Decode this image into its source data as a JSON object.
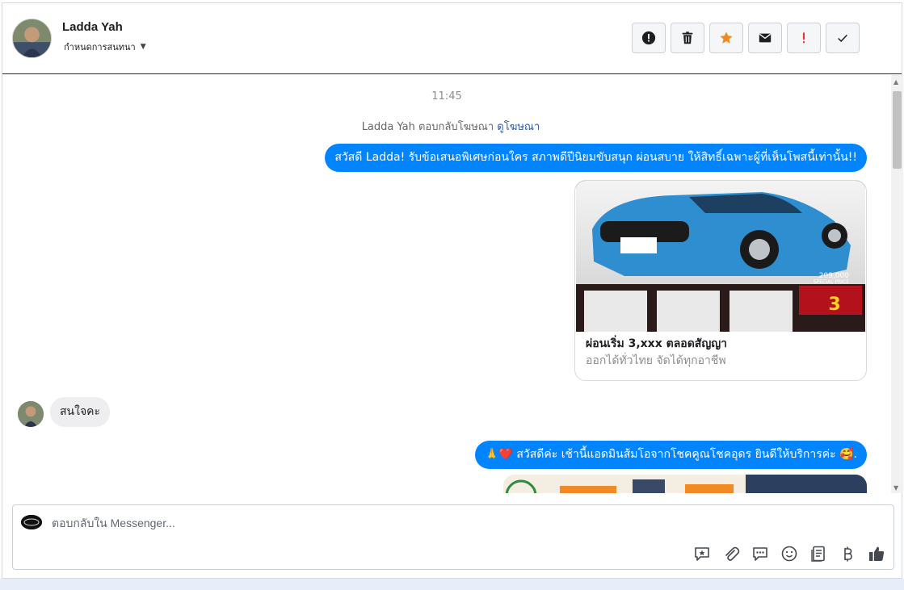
{
  "header": {
    "contact_name": "Ladda Yah",
    "contact_subtitle": "กำหนดการสนทนา",
    "actions": [
      {
        "icon": "alert-circle-icon",
        "name": "mark-spam-button"
      },
      {
        "icon": "trash-icon",
        "name": "delete-button"
      },
      {
        "icon": "star-icon",
        "name": "star-button",
        "color": "#f08a24"
      },
      {
        "icon": "envelope-icon",
        "name": "mark-unread-button"
      },
      {
        "icon": "exclamation-icon",
        "name": "follow-up-button",
        "color": "#e4362a"
      },
      {
        "icon": "checkmark-icon",
        "name": "mark-done-button"
      }
    ]
  },
  "conversation": {
    "timestamp": "11:45",
    "ad_reply_text": "Ladda Yah ตอบกลับโฆษณา",
    "ad_reply_link": "ดูโฆษณา",
    "message_1": "สวัสดี Ladda! รับข้อเสนอพิเศษก่อนใคร สภาพดีปีนิยมขับสนุก ผ่อนสบาย ให้สิทธิ์เฉพาะผู้ที่เห็นโพสนี้เท่านั้น!!",
    "card": {
      "title": "ผ่อนเริ่ม 3,xxx ตลอดสัญญา",
      "subtitle": "ออกได้ทั่วไทย จัดได้ทุกอาชีพ",
      "image_price": "209,000",
      "image_price_caption": "SPECIAL PRICE",
      "image_promo_number": "3"
    },
    "reply_in": "สนใจคะ",
    "message_2_emoji": "🙏❤️",
    "message_2": "สวัสดีค่ะ เช้านี้แอดมินส้มโอจากโชคคูณโชคอุดร ยินดีให้บริการค่ะ",
    "message_2_end_emoji": "🥰."
  },
  "composer": {
    "placeholder": "ตอบกลับใน Messenger...",
    "tools": [
      "saved-reply-icon",
      "attachment-icon",
      "quick-replies-icon",
      "emoji-icon",
      "notes-icon",
      "baht-payment-icon",
      "thumbs-up-icon"
    ]
  },
  "colors": {
    "outgoing_bubble": "#0084ff",
    "incoming_bubble": "#eeeef0",
    "link": "#2c5aa0"
  }
}
